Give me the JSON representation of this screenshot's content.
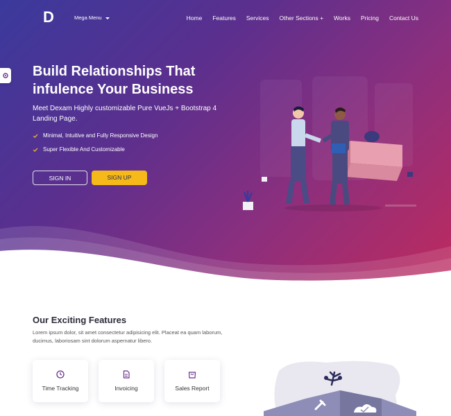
{
  "navbar": {
    "logo_letter": "D",
    "mega_menu_label": "Mega Menu",
    "links": [
      "Home",
      "Features",
      "Services",
      "Other Sections +",
      "Works",
      "Pricing",
      "Contact Us"
    ]
  },
  "hero": {
    "title": "Build Relationships That infulence Your Business",
    "subtitle": "Meet Dexam Highly customizable Pure VueJs + Bootstrap 4 Landing Page.",
    "checks": [
      "Minimal, Intuitive and Fully Responsive Design",
      "Super Flexible And Customizable"
    ],
    "signin_label": "SIGN IN",
    "signup_label": "SIGN UP"
  },
  "features": {
    "title": "Our Exciting Features",
    "description": "Lorem ipsum dolor, sit amet consectetur adipisicing elit. Placeat ea quam laborum, ducimus, laboriosam sint dolorum aspernatur libero.",
    "cards": [
      {
        "label": "Time Tracking",
        "icon": "clock-icon"
      },
      {
        "label": "Invoicing",
        "icon": "document-icon"
      },
      {
        "label": "Sales Report",
        "icon": "shopping-bag-icon"
      }
    ]
  },
  "colors": {
    "gradient_start": "#3a3a9c",
    "gradient_end": "#c02a5c",
    "accent_yellow": "#f6b91a",
    "icon_purple": "#6b2f8e"
  }
}
